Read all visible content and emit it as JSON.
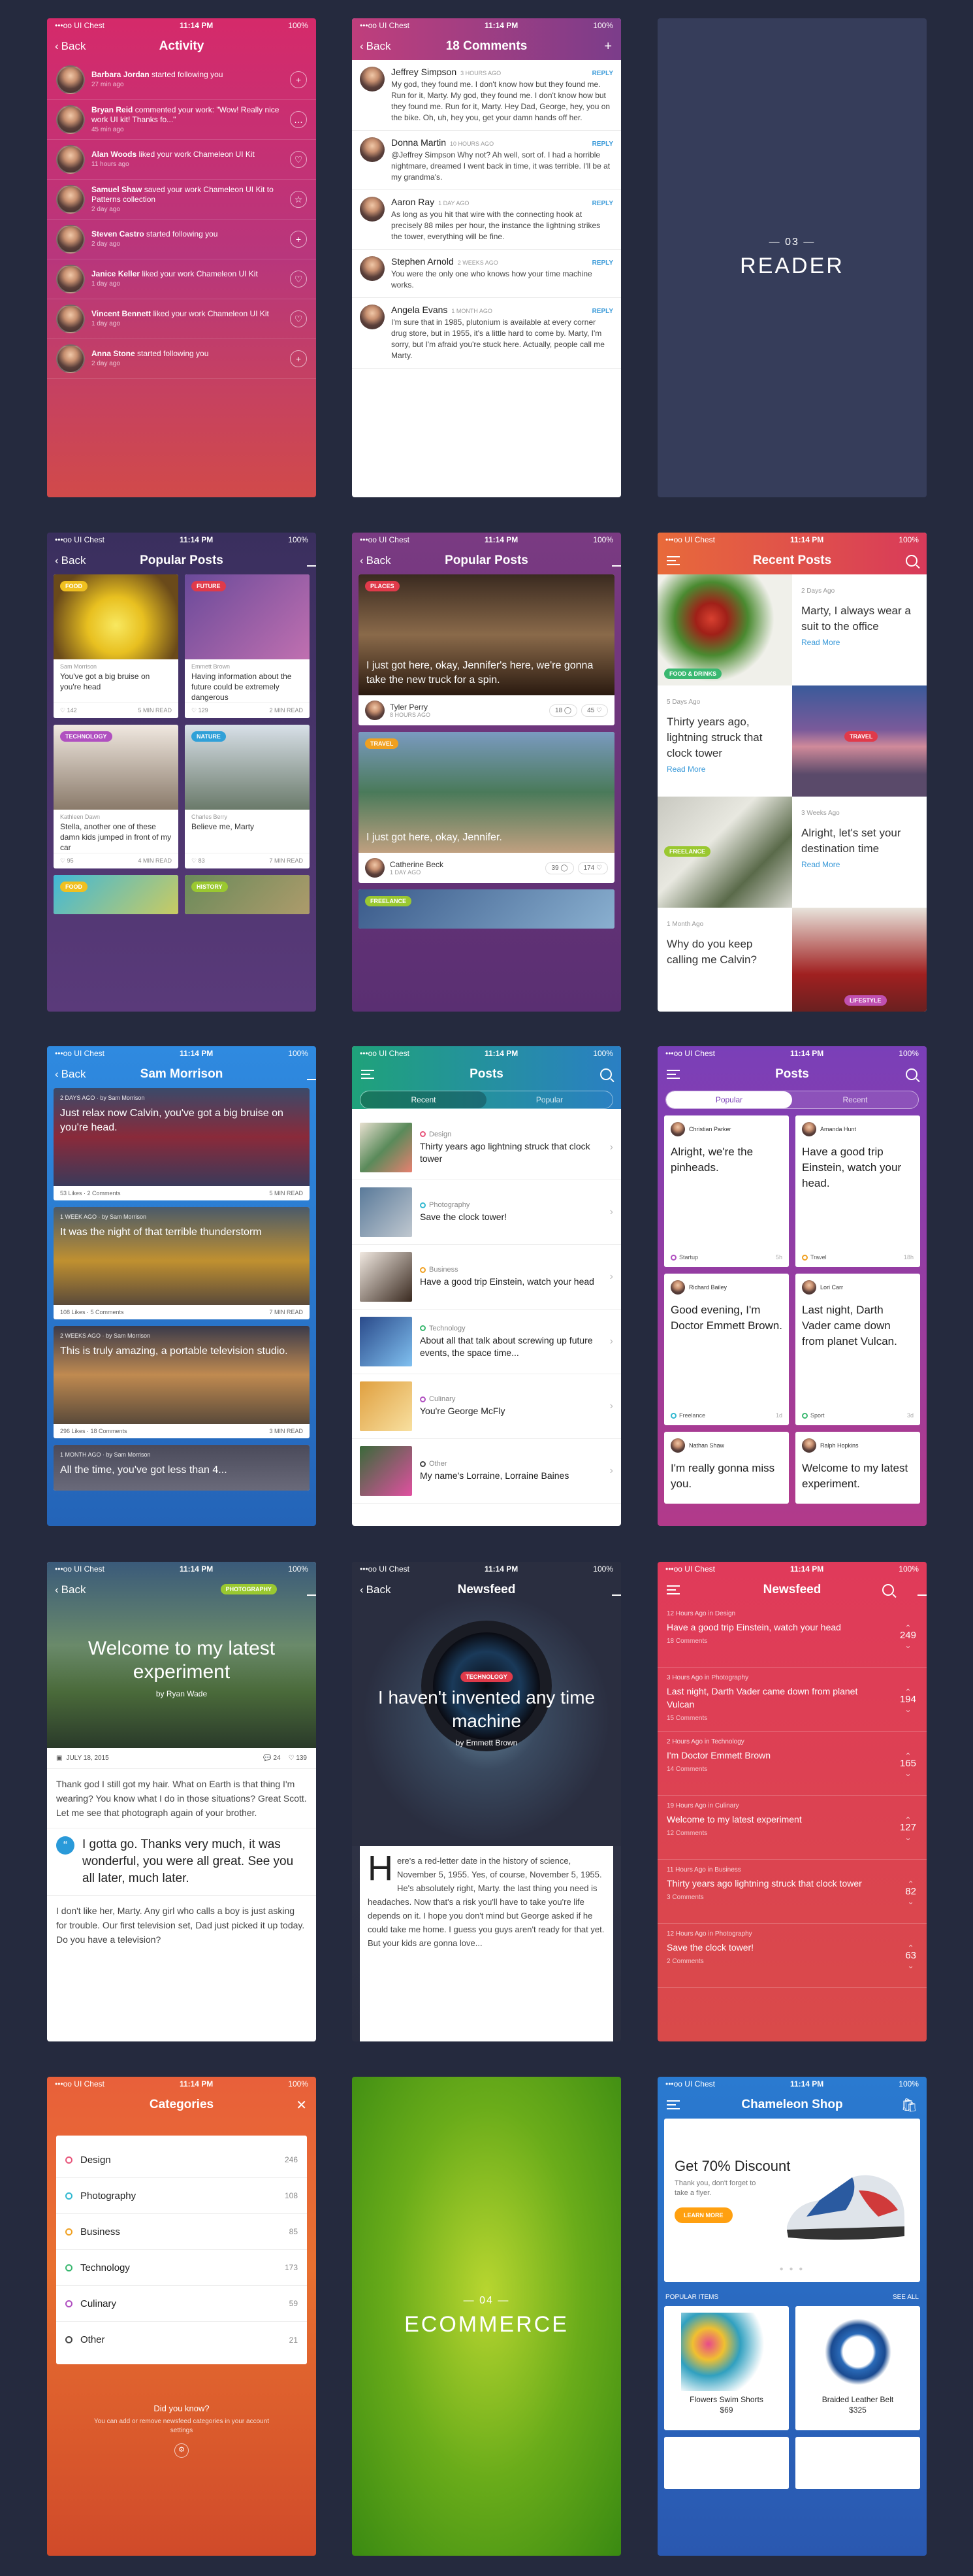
{
  "status": {
    "carrier": "•••oo UI Chest",
    "time": "11:14 PM",
    "battery": "100%"
  },
  "common": {
    "back": "Back"
  },
  "activity": {
    "title": "Activity",
    "items": [
      {
        "name": "Barbara Jordan",
        "text": " started following you",
        "time": "27 min ago",
        "action": "+"
      },
      {
        "name": "Bryan Reid",
        "text": " commented your work: \"Wow! Really nice work UI kit! Thanks fo...\"",
        "time": "45 min ago",
        "action": "…"
      },
      {
        "name": "Alan Woods",
        "text": " liked your work Chameleon UI Kit",
        "time": "11 hours ago",
        "action": "♡"
      },
      {
        "name": "Samuel Shaw",
        "text": " saved your work Chameleon UI Kit to Patterns collection",
        "time": "2 day ago",
        "action": "☆"
      },
      {
        "name": "Steven Castro",
        "text": " started following you",
        "time": "2 day ago",
        "action": "+"
      },
      {
        "name": "Janice Keller",
        "text": " liked your work Chameleon UI Kit",
        "time": "1 day ago",
        "action": "♡"
      },
      {
        "name": "Vincent Bennett",
        "text": " liked your work Chameleon UI Kit",
        "time": "1 day ago",
        "action": "♡"
      },
      {
        "name": "Anna Stone",
        "text": " started following you",
        "time": "2 day ago",
        "action": "+"
      }
    ]
  },
  "comments": {
    "title": "18 Comments",
    "reply": "REPLY",
    "items": [
      {
        "name": "Jeffrey Simpson",
        "time": "3 HOURS AGO",
        "text": "My god, they found me. I don't know how but they found me. Run for it, Marty. My god, they found me. I don't know how but they found me. Run for it, Marty. Hey Dad, George, hey, you on the bike. Oh, uh, hey you, get your damn hands off her."
      },
      {
        "name": "Donna Martin",
        "time": "10 HOURS AGO",
        "text": "@Jeffrey Simpson Why not? Ah well, sort of. I had a horrible nightmare, dreamed I went back in time, it was terrible. I'll be at my grandma's."
      },
      {
        "name": "Aaron Ray",
        "time": "1 DAY AGO",
        "text": "As long as you hit that wire with the connecting hook at precisely 88 miles per hour, the instance the lightning strikes the tower, everything will be fine."
      },
      {
        "name": "Stephen Arnold",
        "time": "2 WEEKS AGO",
        "text": "You were the only one who knows how your time machine works."
      },
      {
        "name": "Angela Evans",
        "time": "1 MONTH AGO",
        "text": "I'm sure that in 1985, plutonium is available at every corner drug store, but in 1955, it's a little hard to come by. Marty, I'm sorry, but I'm afraid you're stuck here. Actually, people call me Marty."
      }
    ]
  },
  "reader": {
    "num": "— 03 —",
    "word": "READER"
  },
  "popular": {
    "title": "Popular Posts",
    "cards": [
      {
        "tag": "FOOD",
        "author": "Sam Morrison",
        "text": "You've got a big bruise on you're head",
        "likes": "142",
        "read": "5 MIN READ"
      },
      {
        "tag": "FUTURE",
        "author": "Emmett Brown",
        "text": "Having information about the future could be extremely dangerous",
        "likes": "129",
        "read": "2 MIN READ"
      },
      {
        "tag": "TECHNOLOGY",
        "author": "Kathleen Dawn",
        "text": "Stella, another one of these damn kids jumped in front of my car",
        "likes": "95",
        "read": "4 MIN READ"
      },
      {
        "tag": "NATURE",
        "author": "Charles Berry",
        "text": "Believe me, Marty",
        "likes": "83",
        "read": "7 MIN READ"
      },
      {
        "tag": "FOOD"
      },
      {
        "tag": "HISTORY"
      }
    ]
  },
  "popular2": {
    "title": "Popular Posts",
    "cards": [
      {
        "tag": "PLACES",
        "text": "I just got here, okay, Jennifer's here, we're gonna take the new truck for a spin.",
        "author": "Tyler Perry",
        "time": "8 HOURS AGO",
        "comments": "18",
        "likes": "45"
      },
      {
        "tag": "TRAVEL",
        "text": "I just got here, okay, Jennifer.",
        "author": "Catherine Beck",
        "time": "1 DAY AGO",
        "comments": "39",
        "likes": "174"
      },
      {
        "tag": "FREELANCE"
      }
    ]
  },
  "recent": {
    "title": "Recent Posts",
    "posts": [
      {
        "tag": "FOOD & DRINKS",
        "date": "2 Days Ago",
        "text": "Marty, I always wear a suit to the office",
        "more": "Read More"
      },
      {
        "tag": "TRAVEL",
        "date": "5 Days Ago",
        "text": "Thirty years ago, lightning struck that clock tower",
        "more": "Read More"
      },
      {
        "tag": "FREELANCE",
        "date": "3 Weeks Ago",
        "text": "Alright, let's set your destination time",
        "more": "Read More"
      },
      {
        "tag": "LIFESTYLE",
        "date": "1 Month Ago",
        "text": "Why do you keep calling me Calvin?"
      }
    ]
  },
  "sam": {
    "title": "Sam Morrison",
    "cards": [
      {
        "date": "2 DAYS AGO",
        "by": "by Sam Morrison",
        "text": "Just relax now Calvin, you've got a big bruise on you're head.",
        "likes": "53 Likes",
        "comments": "2 Comments",
        "read": "5 MIN READ"
      },
      {
        "date": "1 WEEK AGO",
        "by": "by Sam Morrison",
        "text": "It was the night of that terrible thunderstorm",
        "likes": "108 Likes",
        "comments": "5 Comments",
        "read": "7 MIN READ"
      },
      {
        "date": "2 WEEKS AGO",
        "by": "by Sam Morrison",
        "text": "This is truly amazing, a portable television studio.",
        "likes": "296 Likes",
        "comments": "18 Comments",
        "read": "3 MIN READ"
      },
      {
        "date": "1 MONTH AGO",
        "by": "by Sam Morrison",
        "text": "All the time, you've got less than 4..."
      }
    ]
  },
  "posts": {
    "title": "Posts",
    "tabs": [
      "Recent",
      "Popular"
    ],
    "items": [
      {
        "cat": "Design",
        "title": "Thirty years ago lightning struck that clock tower",
        "color": "#e8547a"
      },
      {
        "cat": "Photography",
        "title": "Save the clock tower!",
        "color": "#30b8d0"
      },
      {
        "cat": "Business",
        "title": "Have a good trip Einstein, watch your head",
        "color": "#f0a020"
      },
      {
        "cat": "Technology",
        "title": "About all that talk about screwing up future events, the space time...",
        "color": "#3ab870"
      },
      {
        "cat": "Culinary",
        "title": "You're George McFly",
        "color": "#b050c0"
      },
      {
        "cat": "Other",
        "title": "My name's Lorraine, Lorraine Baines",
        "color": "#444"
      }
    ]
  },
  "quotes": {
    "title": "Posts",
    "tabs": [
      "Popular",
      "Recent"
    ],
    "items": [
      {
        "author": "Christian Parker",
        "q": "Alright, we're the pinheads.",
        "cat": "Startup",
        "n": "5h",
        "color": "#b050c0"
      },
      {
        "author": "Amanda Hunt",
        "q": "Have a good trip Einstein, watch your head.",
        "cat": "Travel",
        "n": "18h",
        "color": "#f0a020"
      },
      {
        "author": "Richard Bailey",
        "q": "Good evening, I'm Doctor Emmett Brown.",
        "cat": "Freelance",
        "n": "1d",
        "color": "#30b8d0"
      },
      {
        "author": "Lori Carr",
        "q": "Last night, Darth Vader came down from planet Vulcan.",
        "cat": "Sport",
        "n": "3d",
        "color": "#3ab870"
      },
      {
        "author": "Nathan Shaw",
        "q": "I'm really gonna miss you."
      },
      {
        "author": "Ralph Hopkins",
        "q": "Welcome to my latest experiment."
      }
    ]
  },
  "article": {
    "tag": "PHOTOGRAPHY",
    "title": "Welcome to my latest experiment",
    "by": "by Ryan Wade",
    "date": "JULY 18, 2015",
    "comments": "24",
    "likes": "139",
    "p1": "Thank god I still got my hair. What on Earth is that thing I'm wearing? You know what I do in those situations? Great Scott. Let me see that photograph again of your brother.",
    "quote": "I gotta go. Thanks very much, it was wonderful, you were all great. See you all later, much later.",
    "p2": "I don't like her, Marty. Any girl who calls a boy is just asking for trouble. Our first television set, Dad just picked it up today. Do you have a television?"
  },
  "newsfeed": {
    "title": "Newsfeed",
    "tag": "TECHNOLOGY",
    "headline": "I haven't invented any time machine",
    "by": "by Emmett Brown",
    "dropcap": "H",
    "body": "ere's a red-letter date in the history of science, November 5, 1955. Yes, of course, November 5, 1955. He's absolutely right, Marty. the last thing you need is headaches. Now that's a risk you'll have to take you're life depends on it. I hope you don't mind but George asked if he could take me home. I guess you guys aren't ready for that yet. But your kids are gonna love..."
  },
  "newsfeed2": {
    "title": "Newsfeed",
    "items": [
      {
        "date": "12 Hours Ago in Design",
        "title": "Have a good trip Einstein, watch your head",
        "comments": "18 Comments",
        "votes": "249"
      },
      {
        "date": "3 Hours Ago in Photography",
        "title": "Last night, Darth Vader came down from planet Vulcan",
        "comments": "15 Comments",
        "votes": "194"
      },
      {
        "date": "2 Hours Ago in Technology",
        "title": "I'm Doctor Emmett Brown",
        "comments": "14 Comments",
        "votes": "165"
      },
      {
        "date": "19 Hours Ago in Culinary",
        "title": "Welcome to my latest experiment",
        "comments": "12 Comments",
        "votes": "127"
      },
      {
        "date": "11 Hours Ago in Business",
        "title": "Thirty years ago lightning struck that clock tower",
        "comments": "3 Comments",
        "votes": "82"
      },
      {
        "date": "12 Hours Ago in Photography",
        "title": "Save the clock tower!",
        "comments": "2 Comments",
        "votes": "63"
      }
    ]
  },
  "categories": {
    "title": "Categories",
    "items": [
      {
        "name": "Design",
        "count": "246",
        "color": "#e8547a"
      },
      {
        "name": "Photography",
        "count": "108",
        "color": "#30b8d0"
      },
      {
        "name": "Business",
        "count": "85",
        "color": "#f0a020"
      },
      {
        "name": "Technology",
        "count": "173",
        "color": "#3ab870"
      },
      {
        "name": "Culinary",
        "count": "59",
        "color": "#b050c0"
      },
      {
        "name": "Other",
        "count": "21",
        "color": "#444"
      }
    ],
    "dyk": "Did you know?",
    "dyktext": "You can add or remove newsfeed categories in your account settings"
  },
  "ecommerce": {
    "num": "— 04 —",
    "word": "ECOMMERCE"
  },
  "shop": {
    "title": "Chameleon Shop",
    "promo": "Get 70% Discount",
    "promotext": "Thank you, don't forget to take a flyer.",
    "btn": "LEARN MORE",
    "popular": "POPULAR ITEMS",
    "seeall": "SEE ALL",
    "items": [
      {
        "name": "Flowers Swim Shorts",
        "price": "$69"
      },
      {
        "name": "Braided Leather Belt",
        "price": "$325"
      }
    ]
  }
}
